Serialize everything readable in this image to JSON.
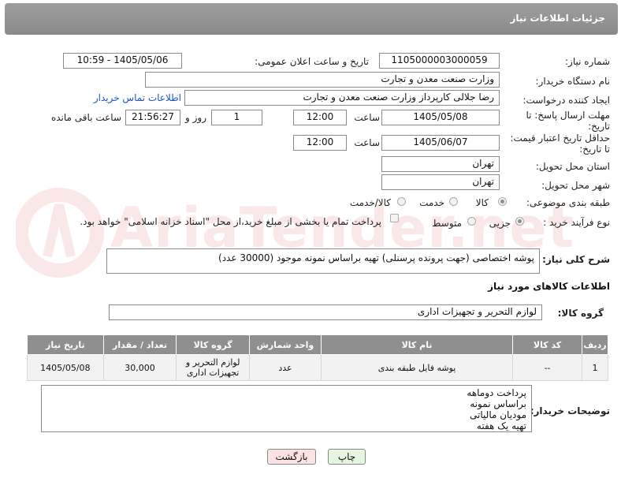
{
  "header": {
    "title": "جزئیات اطلاعات نیاز"
  },
  "need_number": {
    "label": "شماره نیاز:",
    "value": "1105000003000059"
  },
  "announce": {
    "label": "تاریخ و ساعت اعلان عمومی:",
    "value": "1405/05/06 - 10:59"
  },
  "buyer_org": {
    "label": "نام دستگاه خریدار:",
    "value": "وزارت صنعت معدن و تجارت"
  },
  "creator": {
    "label": "ایجاد کننده درخواست:",
    "value": "رضا جلالی کارپرداز وزارت صنعت معدن و تجارت",
    "contact_link": "اطلاعات تماس خریدار"
  },
  "deadline": {
    "label_line1": "مهلت ارسال پاسخ: تا",
    "label_line2": "تاریخ:",
    "date": "1405/05/08",
    "time_label": "ساعت",
    "time": "12:00",
    "days": "1",
    "days_label": "روز و",
    "remaining": "21:56:27",
    "remaining_label": "ساعت باقی مانده"
  },
  "price_validity": {
    "label_line1": "حداقل تاریخ اعتبار قیمت:",
    "label_line2": "تا تاریخ:",
    "date": "1405/06/07",
    "time_label": "ساعت",
    "time": "12:00"
  },
  "province": {
    "label": "استان محل تحویل:",
    "value": "تهران"
  },
  "city": {
    "label": "شهر محل تحویل:",
    "value": "تهران"
  },
  "category": {
    "label": "طبقه بندی موضوعی:",
    "options": [
      "کالا",
      "خدمت",
      "کالا/خدمت"
    ],
    "selected": "کالا"
  },
  "process": {
    "label": "نوع فرآیند خرید :",
    "options": [
      "جزیی",
      "متوسط"
    ],
    "selected": "جزیی",
    "payment_note": "پرداخت تمام یا بخشی از مبلغ خرید،از محل \"اسناد خزانه اسلامی\" خواهد بود."
  },
  "description": {
    "label": "شرح کلی نیاز:",
    "value": "پوشه اختصاصی (جهت پرونده پرسنلی) تهیه براساس نمونه موجود (30000 عدد)"
  },
  "goods_info": {
    "title": "اطلاعات کالاهای مورد نیاز"
  },
  "goods_group": {
    "label": "گروه کالا:",
    "value": "لوازم التحریر و تجهیزات اداری"
  },
  "table": {
    "headers": [
      "ردیف",
      "کد کالا",
      "نام کالا",
      "واحد شمارش",
      "گروه کالا",
      "تعداد / مقدار",
      "تاریخ نیاز"
    ],
    "rows": [
      {
        "row": "1",
        "code": "--",
        "name": "پوشه فایل طبقه بندی",
        "unit": "عدد",
        "group": "لوازم التحریر و تجهیزات اداری",
        "qty": "30,000",
        "date": "1405/05/08"
      }
    ]
  },
  "buyer_notes": {
    "label": "توضیحات خریدار:",
    "lines": [
      "پرداخت دوماهه",
      "براساس نمونه",
      "مودیان مالیاتی",
      "تهیه یک هفته"
    ]
  },
  "buttons": {
    "print": "چاپ",
    "back": "بازگشت"
  },
  "watermark": {
    "text": "AriaTender.net"
  },
  "colors": {
    "header_bg": "#8f8f8f",
    "link": "#1a56c2",
    "print_btn": "#e6f5df",
    "back_btn": "#fbe3e3"
  }
}
